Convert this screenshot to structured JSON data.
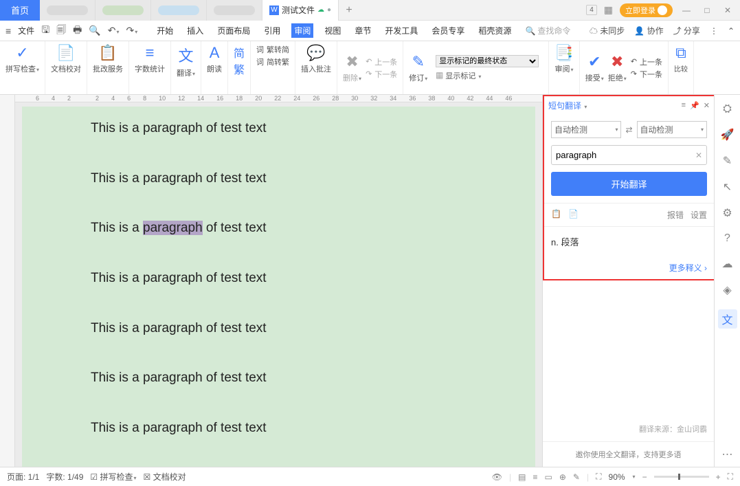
{
  "titlebar": {
    "home": "首页",
    "active_tab": "测试文件",
    "login": "立即登录",
    "badge": "4"
  },
  "menubar": {
    "file": "文件",
    "tabs": [
      "开始",
      "插入",
      "页面布局",
      "引用",
      "审阅",
      "视图",
      "章节",
      "开发工具",
      "会员专享",
      "稻壳资源"
    ],
    "active_tab_index": 4,
    "search_placeholder": "查找命令",
    "sync": "未同步",
    "collab": "协作",
    "share": "分享"
  },
  "ribbon": {
    "spell": "拼写检查",
    "doc_check": "文档校对",
    "approve": "批改服务",
    "wordcount": "字数统计",
    "translate": "翻译",
    "read": "朗读",
    "trad": "繁转简",
    "simp": "简转繁",
    "group_js_simp": "简",
    "group_js_trad": "繁",
    "insert_note": "插入批注",
    "delete": "删除",
    "prev_note": "上一条",
    "next_note": "下一条",
    "edit": "修订",
    "show_mark_label": "显示标记的最终状态",
    "show_mark": "显示标记",
    "review": "审阅",
    "accept": "接受",
    "reject": "拒绝",
    "prev": "上一条",
    "next": "下一条",
    "compare": "比较"
  },
  "ruler_top": [
    "6",
    "4",
    "2",
    "",
    "2",
    "4",
    "6",
    "8",
    "10",
    "12",
    "14",
    "16",
    "18",
    "20",
    "22",
    "24",
    "26",
    "28",
    "30",
    "32",
    "34",
    "36",
    "38",
    "40",
    "42",
    "44",
    "46"
  ],
  "doc": {
    "paragraph": "This is a paragraph of test text",
    "highlighted_word": "paragraph"
  },
  "translation": {
    "title": "短句翻译",
    "lang_from": "自动检测",
    "lang_to": "自动检测",
    "input_value": "paragraph",
    "button": "开始翻译",
    "report": "报错",
    "settings": "设置",
    "result": "n. 段落",
    "more": "更多释义",
    "source": "翻译来源：金山词霸",
    "invite": "邀你使用全文翻译，支持更多语"
  },
  "statusbar": {
    "page": "页面: 1/1",
    "words": "字数: 1/49",
    "spell": "拼写检查",
    "doc_check": "文档校对",
    "zoom": "90%"
  }
}
